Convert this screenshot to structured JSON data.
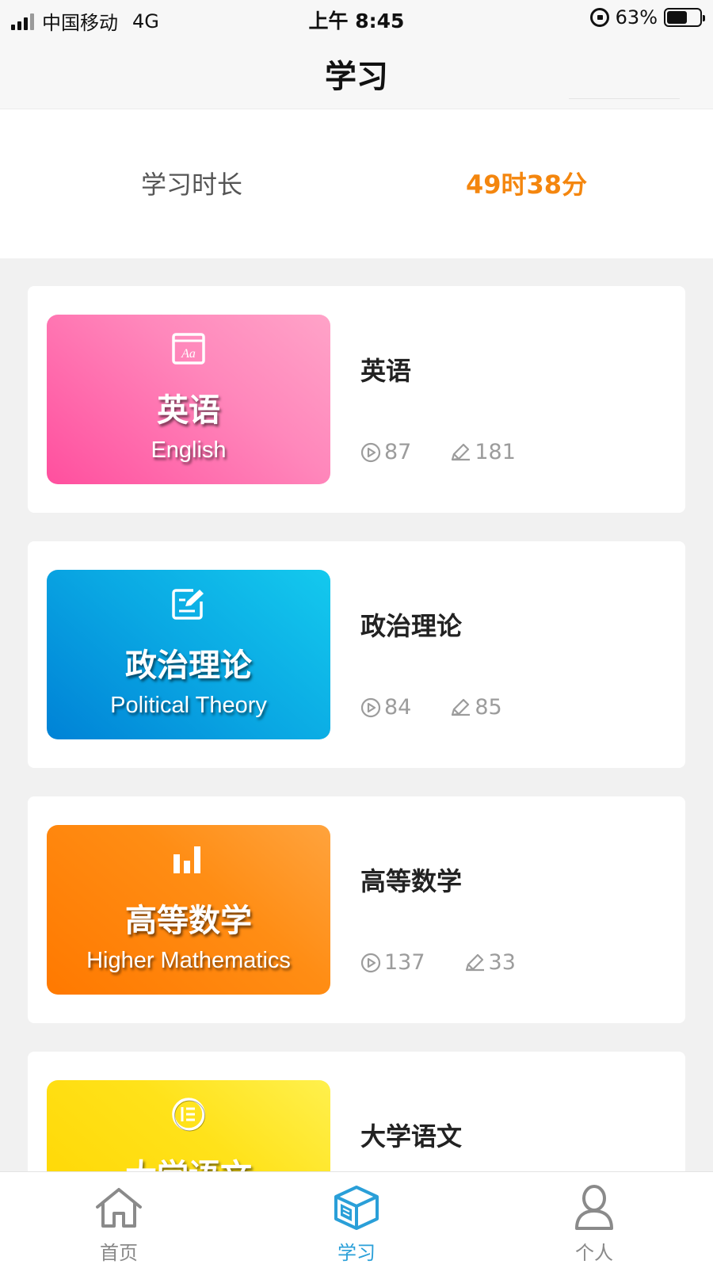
{
  "status_bar": {
    "carrier": "中国移动",
    "network": "4G",
    "time": "上午 8:45",
    "battery": "63%",
    "battery_level": 0.63
  },
  "header": {
    "title": "学习"
  },
  "study_time": {
    "label": "学习时长",
    "value": "49时38分"
  },
  "courses": [
    {
      "title": "英语",
      "cover_cn": "英语",
      "cover_en": "English",
      "cover_icon": "dictionary-icon",
      "color": "#ff5fa6",
      "videos": "87",
      "exercises": "181"
    },
    {
      "title": "政治理论",
      "cover_cn": "政治理论",
      "cover_en": "Political Theory",
      "cover_icon": "edit-icon",
      "color": "#0aa8e3",
      "videos": "84",
      "exercises": "85"
    },
    {
      "title": "高等数学",
      "cover_cn": "高等数学",
      "cover_en": "Higher Mathematics",
      "cover_icon": "bar-chart-icon",
      "color": "#ff8a10",
      "videos": "137",
      "exercises": "33"
    },
    {
      "title": "大学语文",
      "cover_cn": "大学语文",
      "cover_icon": "text-circle-icon",
      "color": "#ffdc10"
    }
  ],
  "tabbar": {
    "items": [
      {
        "label": "首页",
        "icon": "home-icon",
        "active": false
      },
      {
        "label": "学习",
        "icon": "study-cube-icon",
        "active": true
      },
      {
        "label": "个人",
        "icon": "person-icon",
        "active": false
      }
    ],
    "active_color": "#2a9fd8"
  }
}
